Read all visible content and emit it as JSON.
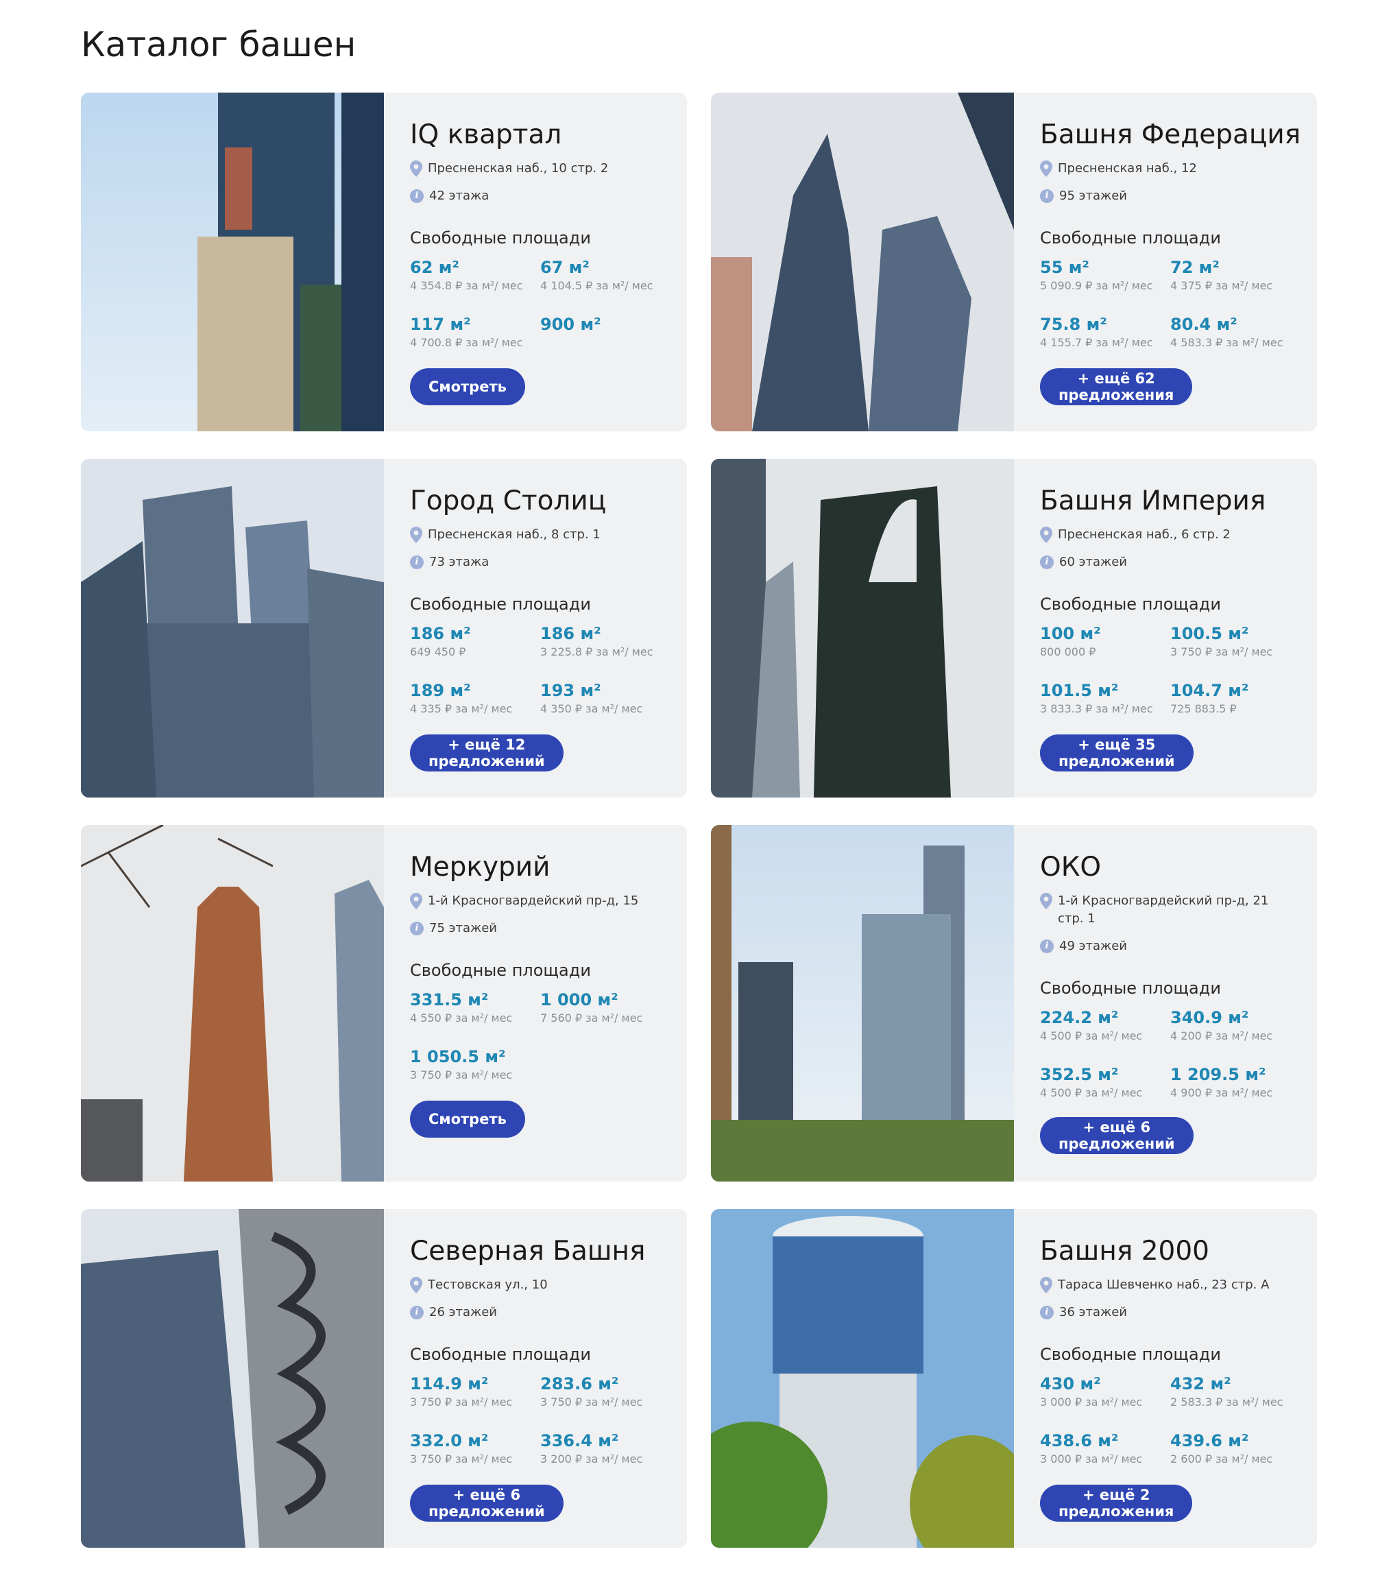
{
  "page": {
    "title": "Каталог башен",
    "free_title": "Свободные площади",
    "unit": "м²"
  },
  "towers": [
    {
      "name": "IQ квартал",
      "address": "Пресненская наб., 10 стр. 2",
      "floors": "42 этажа",
      "offers": [
        {
          "area": "62 м²",
          "price": "4 354.8 ₽ за м²/ мес"
        },
        {
          "area": "67 м²",
          "price": "4 104.5 ₽ за м²/ мес"
        },
        {
          "area": "117 м²",
          "price": "4 700.8 ₽ за м²/ мес"
        },
        {
          "area": "900 м²",
          "price": ""
        }
      ],
      "button": "Смотреть"
    },
    {
      "name": "Башня Федерация",
      "address": "Пресненская наб., 12",
      "floors": "95 этажей",
      "offers": [
        {
          "area": "55 м²",
          "price": "5 090.9 ₽ за м²/ мес"
        },
        {
          "area": "72 м²",
          "price": "4 375 ₽ за м²/ мес"
        },
        {
          "area": "75.8 м²",
          "price": "4 155.7 ₽ за м²/ мес"
        },
        {
          "area": "80.4 м²",
          "price": "4 583.3 ₽ за м²/ мес"
        }
      ],
      "button": "+ ещё 62 предложения"
    },
    {
      "name": "Город Столиц",
      "address": "Пресненская наб., 8 стр. 1",
      "floors": "73 этажа",
      "offers": [
        {
          "area": "186 м²",
          "price": "649 450 ₽"
        },
        {
          "area": "186 м²",
          "price": "3 225.8 ₽ за м²/ мес"
        },
        {
          "area": "189 м²",
          "price": "4 335 ₽ за м²/ мес"
        },
        {
          "area": "193 м²",
          "price": "4 350 ₽ за м²/ мес"
        }
      ],
      "button": "+ ещё 12 предложений"
    },
    {
      "name": "Башня Империя",
      "address": "Пресненская наб., 6 стр. 2",
      "floors": "60 этажей",
      "offers": [
        {
          "area": "100 м²",
          "price": "800 000 ₽"
        },
        {
          "area": "100.5 м²",
          "price": "3 750 ₽ за м²/ мес"
        },
        {
          "area": "101.5 м²",
          "price": "3 833.3 ₽ за м²/ мес"
        },
        {
          "area": "104.7 м²",
          "price": "725 883.5 ₽"
        }
      ],
      "button": "+ ещё 35 предложений"
    },
    {
      "name": "Меркурий",
      "address": "1-й Красногвардейский пр-д, 15",
      "floors": "75 этажей",
      "offers": [
        {
          "area": "331.5 м²",
          "price": "4 550 ₽ за м²/ мес"
        },
        {
          "area": "1 000 м²",
          "price": "7 560 ₽ за м²/ мес"
        },
        {
          "area": "1 050.5 м²",
          "price": "3 750 ₽ за м²/ мес"
        }
      ],
      "button": "Смотреть"
    },
    {
      "name": "ОКО",
      "address": "1-й Красногвардейский пр-д, 21 стр. 1",
      "floors": "49 этажей",
      "offers": [
        {
          "area": "224.2 м²",
          "price": "4 500 ₽ за м²/ мес"
        },
        {
          "area": "340.9 м²",
          "price": "4 200 ₽ за м²/ мес"
        },
        {
          "area": "352.5 м²",
          "price": "4 500 ₽ за м²/ мес"
        },
        {
          "area": "1 209.5 м²",
          "price": "4 900 ₽ за м²/ мес"
        }
      ],
      "button": "+ ещё 6 предложений"
    },
    {
      "name": "Северная Башня",
      "address": "Тестовская ул., 10",
      "floors": "26 этажей",
      "offers": [
        {
          "area": "114.9 м²",
          "price": "3 750 ₽ за м²/ мес"
        },
        {
          "area": "283.6 м²",
          "price": "3 750 ₽ за м²/ мес"
        },
        {
          "area": "332.0 м²",
          "price": "3 750 ₽ за м²/ мес"
        },
        {
          "area": "336.4 м²",
          "price": "3 200 ₽ за м²/ мес"
        }
      ],
      "button": "+ ещё 6 предложений"
    },
    {
      "name": "Башня 2000",
      "address": "Тараса Шевченко наб., 23 стр. А",
      "floors": "36 этажей",
      "offers": [
        {
          "area": "430 м²",
          "price": "3 000 ₽ за м²/ мес"
        },
        {
          "area": "432 м²",
          "price": "2 583.3 ₽ за м²/ мес"
        },
        {
          "area": "438.6 м²",
          "price": "3 000 ₽ за м²/ мес"
        },
        {
          "area": "439.6 м²",
          "price": "2 600 ₽ за м²/ мес"
        }
      ],
      "button": "+ ещё 2 предложения"
    }
  ],
  "colors": {
    "card_bg": "#eff1f3",
    "area_text": "#1e87b4",
    "button_bg": "#2e45b3",
    "icon": "#9fb0d8"
  },
  "icons": {
    "address": "map-pin-icon",
    "floors": "info-icon"
  }
}
